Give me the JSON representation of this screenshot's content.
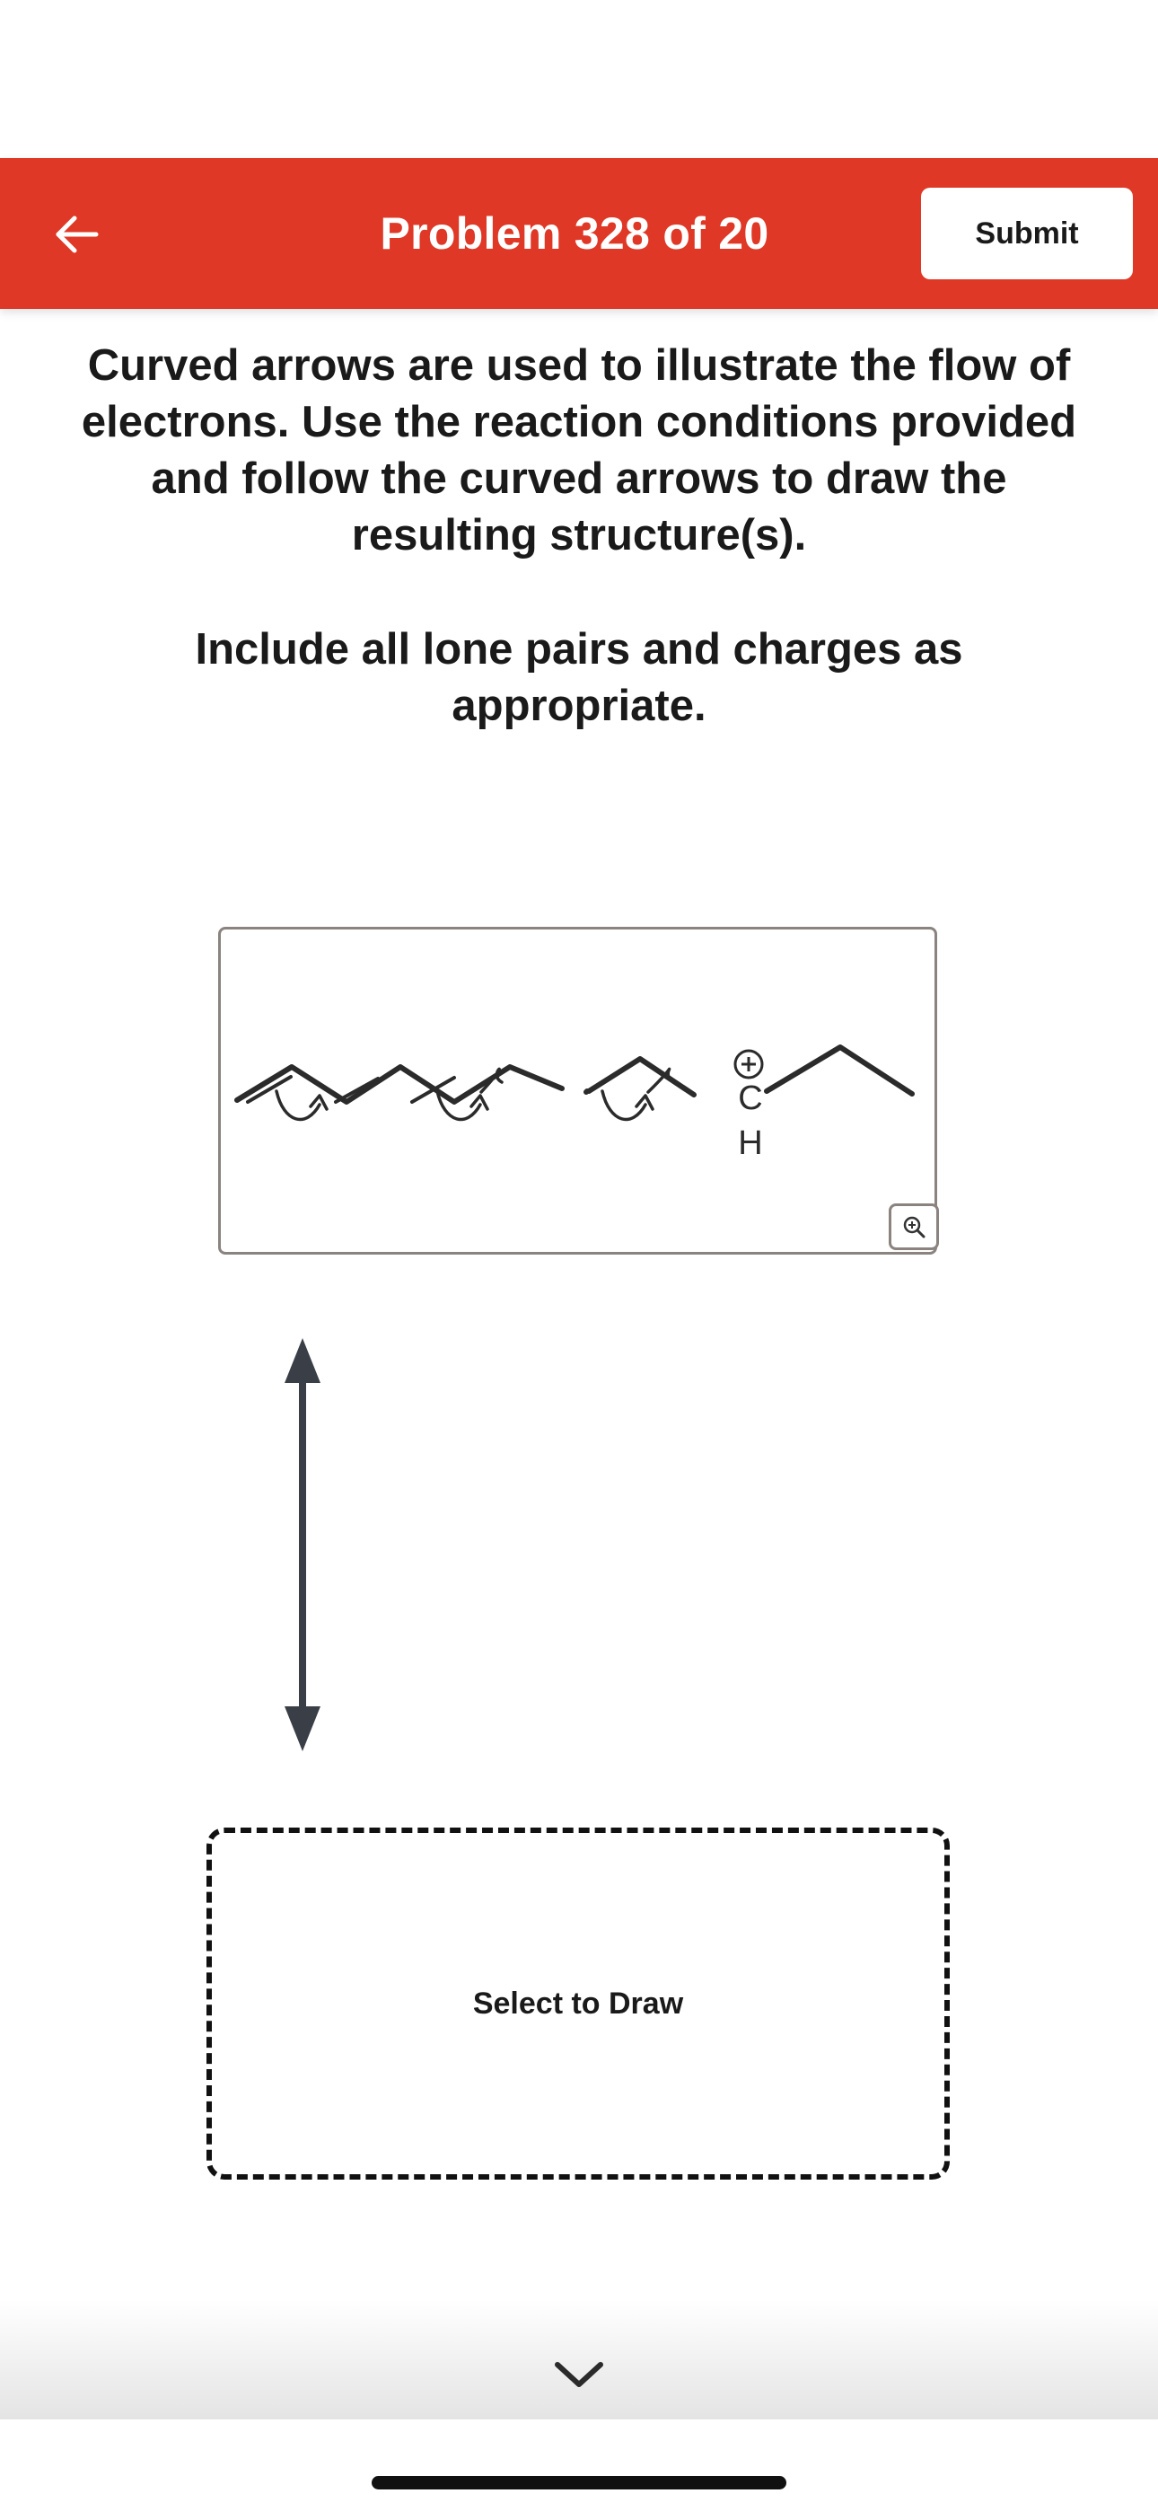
{
  "header": {
    "title": "Problem 328 of 20",
    "submit_label": "Submit",
    "back_icon": "arrow-left-icon",
    "background_color": "#df3826"
  },
  "instructions": {
    "main": "Curved arrows are used to illustrate the flow of electrons. Use the reaction conditions provided and follow the curved arrows to draw the resulting structure(s).",
    "note": "Include all lone pairs and charges as appropriate."
  },
  "molecule": {
    "carbon_label": "C",
    "hydrogen_label": "H",
    "charge_symbol": "+",
    "zoom_icon": "zoom-in-icon"
  },
  "resonance_arrow_icon": "double-headed-arrow-icon",
  "draw_area": {
    "label": "Select to Draw"
  },
  "bottom_bar": {
    "chevron_icon": "chevron-down-icon"
  }
}
